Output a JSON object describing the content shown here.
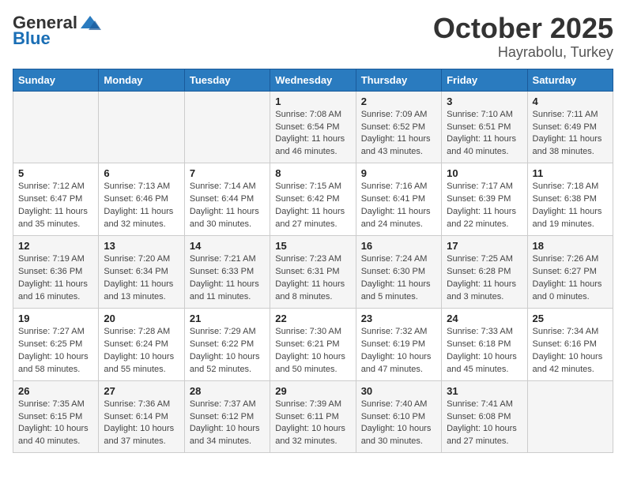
{
  "logo": {
    "general": "General",
    "blue": "Blue"
  },
  "title": "October 2025",
  "location": "Hayrabolu, Turkey",
  "days_header": [
    "Sunday",
    "Monday",
    "Tuesday",
    "Wednesday",
    "Thursday",
    "Friday",
    "Saturday"
  ],
  "weeks": [
    [
      {
        "day": "",
        "info": ""
      },
      {
        "day": "",
        "info": ""
      },
      {
        "day": "",
        "info": ""
      },
      {
        "day": "1",
        "info": "Sunrise: 7:08 AM\nSunset: 6:54 PM\nDaylight: 11 hours and 46 minutes."
      },
      {
        "day": "2",
        "info": "Sunrise: 7:09 AM\nSunset: 6:52 PM\nDaylight: 11 hours and 43 minutes."
      },
      {
        "day": "3",
        "info": "Sunrise: 7:10 AM\nSunset: 6:51 PM\nDaylight: 11 hours and 40 minutes."
      },
      {
        "day": "4",
        "info": "Sunrise: 7:11 AM\nSunset: 6:49 PM\nDaylight: 11 hours and 38 minutes."
      }
    ],
    [
      {
        "day": "5",
        "info": "Sunrise: 7:12 AM\nSunset: 6:47 PM\nDaylight: 11 hours and 35 minutes."
      },
      {
        "day": "6",
        "info": "Sunrise: 7:13 AM\nSunset: 6:46 PM\nDaylight: 11 hours and 32 minutes."
      },
      {
        "day": "7",
        "info": "Sunrise: 7:14 AM\nSunset: 6:44 PM\nDaylight: 11 hours and 30 minutes."
      },
      {
        "day": "8",
        "info": "Sunrise: 7:15 AM\nSunset: 6:42 PM\nDaylight: 11 hours and 27 minutes."
      },
      {
        "day": "9",
        "info": "Sunrise: 7:16 AM\nSunset: 6:41 PM\nDaylight: 11 hours and 24 minutes."
      },
      {
        "day": "10",
        "info": "Sunrise: 7:17 AM\nSunset: 6:39 PM\nDaylight: 11 hours and 22 minutes."
      },
      {
        "day": "11",
        "info": "Sunrise: 7:18 AM\nSunset: 6:38 PM\nDaylight: 11 hours and 19 minutes."
      }
    ],
    [
      {
        "day": "12",
        "info": "Sunrise: 7:19 AM\nSunset: 6:36 PM\nDaylight: 11 hours and 16 minutes."
      },
      {
        "day": "13",
        "info": "Sunrise: 7:20 AM\nSunset: 6:34 PM\nDaylight: 11 hours and 13 minutes."
      },
      {
        "day": "14",
        "info": "Sunrise: 7:21 AM\nSunset: 6:33 PM\nDaylight: 11 hours and 11 minutes."
      },
      {
        "day": "15",
        "info": "Sunrise: 7:23 AM\nSunset: 6:31 PM\nDaylight: 11 hours and 8 minutes."
      },
      {
        "day": "16",
        "info": "Sunrise: 7:24 AM\nSunset: 6:30 PM\nDaylight: 11 hours and 5 minutes."
      },
      {
        "day": "17",
        "info": "Sunrise: 7:25 AM\nSunset: 6:28 PM\nDaylight: 11 hours and 3 minutes."
      },
      {
        "day": "18",
        "info": "Sunrise: 7:26 AM\nSunset: 6:27 PM\nDaylight: 11 hours and 0 minutes."
      }
    ],
    [
      {
        "day": "19",
        "info": "Sunrise: 7:27 AM\nSunset: 6:25 PM\nDaylight: 10 hours and 58 minutes."
      },
      {
        "day": "20",
        "info": "Sunrise: 7:28 AM\nSunset: 6:24 PM\nDaylight: 10 hours and 55 minutes."
      },
      {
        "day": "21",
        "info": "Sunrise: 7:29 AM\nSunset: 6:22 PM\nDaylight: 10 hours and 52 minutes."
      },
      {
        "day": "22",
        "info": "Sunrise: 7:30 AM\nSunset: 6:21 PM\nDaylight: 10 hours and 50 minutes."
      },
      {
        "day": "23",
        "info": "Sunrise: 7:32 AM\nSunset: 6:19 PM\nDaylight: 10 hours and 47 minutes."
      },
      {
        "day": "24",
        "info": "Sunrise: 7:33 AM\nSunset: 6:18 PM\nDaylight: 10 hours and 45 minutes."
      },
      {
        "day": "25",
        "info": "Sunrise: 7:34 AM\nSunset: 6:16 PM\nDaylight: 10 hours and 42 minutes."
      }
    ],
    [
      {
        "day": "26",
        "info": "Sunrise: 7:35 AM\nSunset: 6:15 PM\nDaylight: 10 hours and 40 minutes."
      },
      {
        "day": "27",
        "info": "Sunrise: 7:36 AM\nSunset: 6:14 PM\nDaylight: 10 hours and 37 minutes."
      },
      {
        "day": "28",
        "info": "Sunrise: 7:37 AM\nSunset: 6:12 PM\nDaylight: 10 hours and 34 minutes."
      },
      {
        "day": "29",
        "info": "Sunrise: 7:39 AM\nSunset: 6:11 PM\nDaylight: 10 hours and 32 minutes."
      },
      {
        "day": "30",
        "info": "Sunrise: 7:40 AM\nSunset: 6:10 PM\nDaylight: 10 hours and 30 minutes."
      },
      {
        "day": "31",
        "info": "Sunrise: 7:41 AM\nSunset: 6:08 PM\nDaylight: 10 hours and 27 minutes."
      },
      {
        "day": "",
        "info": ""
      }
    ]
  ]
}
